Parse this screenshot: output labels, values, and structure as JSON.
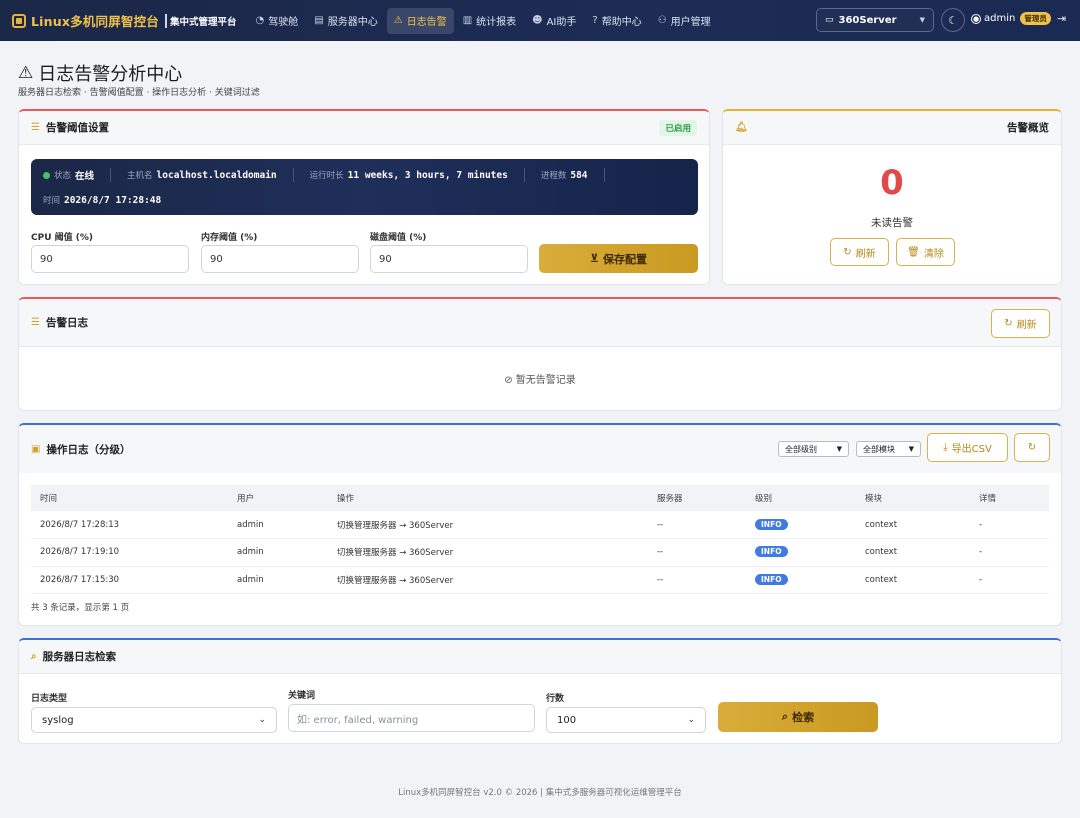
{
  "nav": {
    "brand_title": "Linux多机同屏智控台",
    "brand_sub": "集中式管理平台",
    "items": [
      {
        "label": "驾驶舱",
        "icon": "gauge-icon",
        "glyph": "◔"
      },
      {
        "label": "服务器中心",
        "icon": "server-icon",
        "glyph": "▤"
      },
      {
        "label": "日志告警",
        "icon": "warning-icon",
        "glyph": "⚠"
      },
      {
        "label": "统计报表",
        "icon": "bar-chart-icon",
        "glyph": "▥"
      },
      {
        "label": "AI助手",
        "icon": "robot-icon",
        "glyph": "☻"
      },
      {
        "label": "帮助中心",
        "icon": "help-icon",
        "glyph": "?"
      },
      {
        "label": "用户管理",
        "icon": "users-icon",
        "glyph": "⚇"
      }
    ],
    "active_index": 2,
    "server_select": "360Server",
    "username": "admin",
    "role_badge": "管理员"
  },
  "page": {
    "title": "日志告警分析中心",
    "subtitle": "服务器日志检索 · 告警阈值配置 · 操作日志分析 · 关键词过滤"
  },
  "threshold": {
    "title": "告警阈值设置",
    "status_badge": "已启用",
    "status": {
      "state_label": "状态",
      "state": "在线",
      "host_label": "主机名",
      "host": "localhost.localdomain",
      "uptime_label": "运行时长",
      "uptime": "11 weeks, 3 hours, 7 minutes",
      "proc_label": "进程数",
      "proc": "584",
      "time_label": "时间",
      "time": "2026/8/7 17:28:48"
    },
    "cpu_label": "CPU 阈值 (%)",
    "cpu_value": "90",
    "mem_label": "内存阈值 (%)",
    "mem_value": "90",
    "disk_label": "磁盘阈值 (%)",
    "disk_value": "90",
    "save_label": "保存配置"
  },
  "overview": {
    "title": "告警概览",
    "unread_count": "0",
    "unread_label": "未读告警",
    "refresh_label": "刷新",
    "clear_label": "清除"
  },
  "alert_log": {
    "title": "告警日志",
    "refresh_label": "刷新",
    "empty_text": "暂无告警记录"
  },
  "op_log": {
    "title": "操作日志（分级）",
    "level_filter": "全部级别",
    "module_filter": "全部模块",
    "export_label": "导出CSV",
    "columns": [
      "时间",
      "用户",
      "操作",
      "服务器",
      "级别",
      "模块",
      "详情"
    ],
    "rows": [
      [
        "2026/8/7 17:28:13",
        "admin",
        "切换管理服务器 → 360Server",
        "--",
        "INFO",
        "context",
        "-"
      ],
      [
        "2026/8/7 17:19:10",
        "admin",
        "切换管理服务器 → 360Server",
        "--",
        "INFO",
        "context",
        "-"
      ],
      [
        "2026/8/7 17:15:30",
        "admin",
        "切换管理服务器 → 360Server",
        "--",
        "INFO",
        "context",
        "-"
      ]
    ],
    "summary": "共 3 条记录，显示第 1 页"
  },
  "search": {
    "title": "服务器日志检索",
    "type_label": "日志类型",
    "type_value": "syslog",
    "keyword_label": "关键词",
    "keyword_placeholder": "如: error, failed, warning",
    "lines_label": "行数",
    "lines_value": "100",
    "search_label": "检索"
  },
  "footer": "Linux多机同屏智控台 v2.0 © 2026 | 集中式多服务器可视化运维管理平台",
  "colors": {
    "nav_bg": "#1b2747",
    "accent_gold": "#e3b33c",
    "danger": "#e24a4a",
    "info_badge": "#3f7be3"
  }
}
